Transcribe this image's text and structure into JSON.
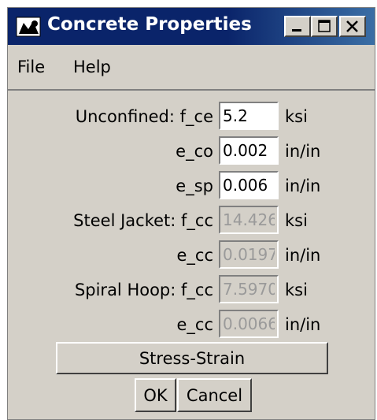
{
  "window": {
    "title": "Concrete Properties",
    "controls": [
      "minimize-icon",
      "maximize-icon",
      "close-icon"
    ]
  },
  "menu": {
    "items": [
      "File",
      "Help"
    ]
  },
  "unconfined": {
    "label_fce": "Unconfined: f_ce",
    "fce_value": "5.2",
    "fce_unit": "ksi",
    "label_eco": "e_co",
    "eco_value": "0.002",
    "eco_unit": "in/in",
    "label_esp": "e_sp",
    "esp_value": "0.006",
    "esp_unit": "in/in"
  },
  "steel_jacket": {
    "label_fcc": "Steel Jacket: f_cc",
    "fcc_value": "14.426",
    "fcc_unit": "ksi",
    "label_ecc": "e_cc",
    "ecc_value": "0.0197",
    "ecc_unit": "in/in"
  },
  "spiral_hoop": {
    "label_fcc": "Spiral Hoop: f_cc",
    "fcc_value": "7.5970",
    "fcc_unit": "ksi",
    "label_ecc": "e_cc",
    "ecc_value": "0.0066",
    "ecc_unit": "in/in"
  },
  "buttons": {
    "stress_strain": "Stress-Strain",
    "ok": "OK",
    "cancel": "Cancel"
  },
  "colors": {
    "titlebar": "#0a246a",
    "face": "#d4d0c8",
    "disabled_text": "#9a9a9a"
  }
}
